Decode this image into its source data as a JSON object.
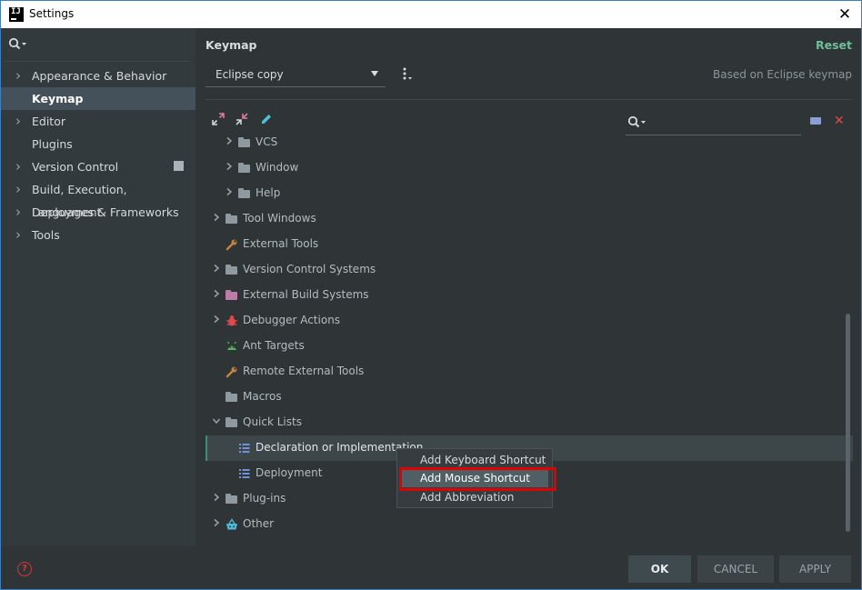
{
  "window": {
    "title": "Settings",
    "close_glyph": "✕"
  },
  "sidebar": {
    "items": [
      {
        "label": "Appearance & Behavior",
        "expandable": true,
        "selected": false
      },
      {
        "label": "Keymap",
        "expandable": false,
        "selected": true
      },
      {
        "label": "Editor",
        "expandable": true,
        "selected": false
      },
      {
        "label": "Plugins",
        "expandable": false,
        "selected": false
      },
      {
        "label": "Version Control",
        "expandable": true,
        "selected": false
      },
      {
        "label": "Build, Execution, Deployment",
        "expandable": true,
        "selected": false
      },
      {
        "label": "Languages & Frameworks",
        "expandable": true,
        "selected": false
      },
      {
        "label": "Tools",
        "expandable": true,
        "selected": false
      }
    ]
  },
  "keymap": {
    "title": "Keymap",
    "reset_label": "Reset",
    "selected_keymap": "Eclipse copy",
    "based_on": "Based on Eclipse keymap",
    "search_value": ""
  },
  "tree": [
    {
      "label": "VCS",
      "icon": "folder-icon",
      "expand": "collapsed",
      "level": 1
    },
    {
      "label": "Window",
      "icon": "folder-icon",
      "expand": "collapsed",
      "level": 1
    },
    {
      "label": "Help",
      "icon": "folder-icon",
      "expand": "collapsed",
      "level": 1
    },
    {
      "label": "Tool Windows",
      "icon": "folder-icon",
      "expand": "collapsed",
      "level": 0
    },
    {
      "label": "External Tools",
      "icon": "wrench-icon",
      "expand": "none",
      "level": 0
    },
    {
      "label": "Version Control Systems",
      "icon": "folder-icon",
      "expand": "collapsed",
      "level": 0
    },
    {
      "label": "External Build Systems",
      "icon": "pink-folder-icon",
      "expand": "collapsed",
      "level": 0
    },
    {
      "label": "Debugger Actions",
      "icon": "bug-icon",
      "expand": "collapsed",
      "level": 0
    },
    {
      "label": "Ant Targets",
      "icon": "ant-icon",
      "expand": "none",
      "level": 0
    },
    {
      "label": "Remote External Tools",
      "icon": "wrench-icon",
      "expand": "none",
      "level": 0
    },
    {
      "label": "Macros",
      "icon": "folder-icon",
      "expand": "none",
      "level": 0
    },
    {
      "label": "Quick Lists",
      "icon": "folder-icon",
      "expand": "expanded",
      "level": 0
    },
    {
      "label": "Declaration or Implementation",
      "icon": "list-icon",
      "expand": "none",
      "level": 1,
      "selected": true
    },
    {
      "label": "Deployment",
      "icon": "list-icon",
      "expand": "none",
      "level": 1
    },
    {
      "label": "Plug-ins",
      "icon": "folder-icon",
      "expand": "collapsed",
      "level": 0
    },
    {
      "label": "Other",
      "icon": "basket-icon",
      "expand": "collapsed",
      "level": 0
    }
  ],
  "context_menu": {
    "items": [
      {
        "label": "Add Keyboard Shortcut",
        "highlighted": false
      },
      {
        "label": "Add Mouse Shortcut",
        "highlighted": true
      },
      {
        "label": "Add Abbreviation",
        "highlighted": false
      }
    ]
  },
  "footer": {
    "ok_label": "OK",
    "cancel_label": "CANCEL",
    "apply_label": "APPLY"
  },
  "colors": {
    "accent_green": "#6fbf9a",
    "highlight_red": "#e00000",
    "selection": "#45515a"
  }
}
